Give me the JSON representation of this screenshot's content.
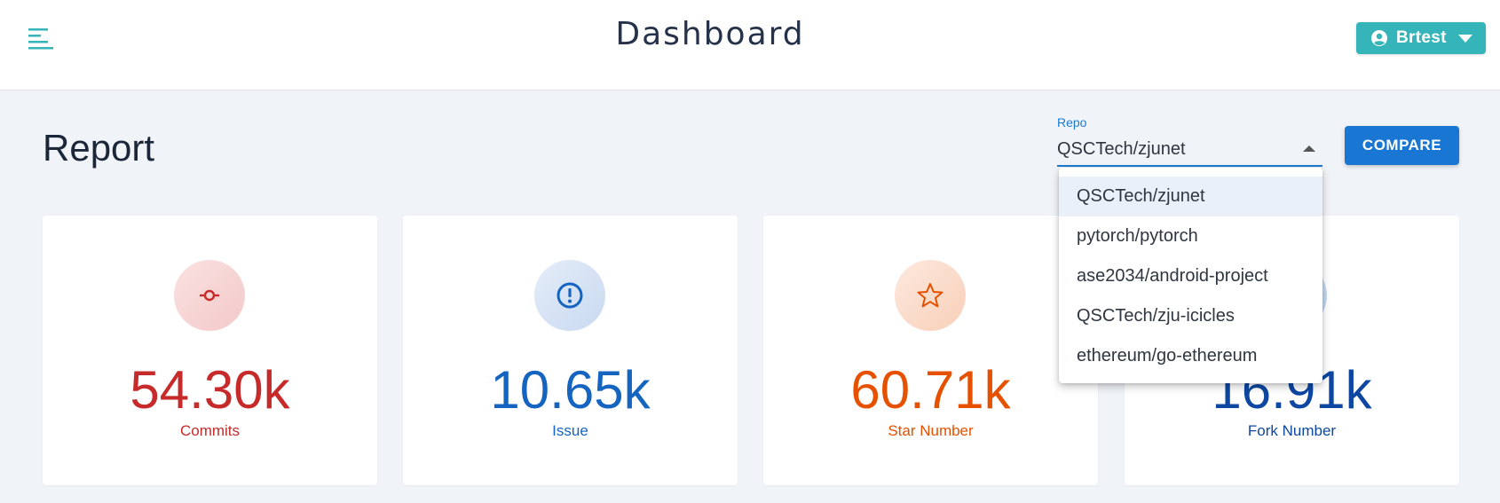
{
  "header": {
    "title": "Dashboard",
    "user": {
      "name": "Brtest"
    }
  },
  "report": {
    "title": "Report",
    "repo_select": {
      "label": "Repo",
      "value": "QSCTech/zjunet",
      "options": [
        "QSCTech/zjunet",
        "pytorch/pytorch",
        "ase2034/android-project",
        "QSCTech/zju-icicles",
        "ethereum/go-ethereum"
      ]
    },
    "compare_label": "COMPARE"
  },
  "stats": [
    {
      "value": "54.30k",
      "label": "Commits",
      "icon": "commit-icon",
      "color": "#c62a2a"
    },
    {
      "value": "10.65k",
      "label": "Issue",
      "icon": "issue-icon",
      "color": "#1565c0"
    },
    {
      "value": "60.71k",
      "label": "Star Number",
      "icon": "star-icon",
      "color": "#e65100"
    },
    {
      "value": "16.91k",
      "label": "Fork Number",
      "icon": "fork-icon",
      "color": "#0d47a1"
    }
  ],
  "colors": {
    "accent_teal": "#35b5b9",
    "primary_blue": "#1976d2",
    "background": "#f0f3f8"
  }
}
